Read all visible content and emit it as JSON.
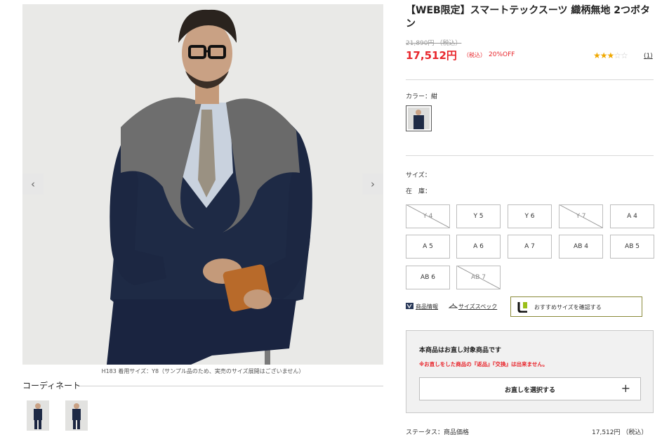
{
  "gallery": {
    "prev_label": "‹",
    "next_label": "›",
    "caption": "H183 着用サイズ：Y8（サンプル品のため、実売のサイズ展開はございません）",
    "coordinate_title": "コーディネート"
  },
  "product": {
    "title": "【WEB限定】スマートテックスーツ 織柄無地 2つボタン",
    "original_price": "21,890円 （税込）",
    "price": "17,512円",
    "price_tax": "（税込）",
    "discount": "20%OFF",
    "rating": {
      "value": 3,
      "max": 5,
      "filled": "★★★",
      "empty": "☆☆"
    },
    "review_count": "(1)"
  },
  "color": {
    "label": "カラー：",
    "value": "紺"
  },
  "size": {
    "label": "サイズ：",
    "stock_label": "在　庫：",
    "options": [
      {
        "label": "Y 4",
        "soldout": true
      },
      {
        "label": "Y 5",
        "soldout": false
      },
      {
        "label": "Y 6",
        "soldout": false
      },
      {
        "label": "Y 7",
        "soldout": true
      },
      {
        "label": "A 4",
        "soldout": false
      },
      {
        "label": "A 5",
        "soldout": false
      },
      {
        "label": "A 6",
        "soldout": false
      },
      {
        "label": "A 7",
        "soldout": false
      },
      {
        "label": "AB 4",
        "soldout": false
      },
      {
        "label": "AB 5",
        "soldout": false
      },
      {
        "label": "AB 6",
        "soldout": false
      },
      {
        "label": "AB 7",
        "soldout": true
      }
    ]
  },
  "links": {
    "product_info": "商品情報",
    "size_spec": "サイズスペック",
    "recommend": "おすすめサイズを確認する"
  },
  "alteration": {
    "title": "本商品はお直し対象商品です",
    "warning": "※お直しをした商品の『返品』『交換』は出来ません。",
    "button_label": "お直しを選択する",
    "button_icon": "+"
  },
  "status": {
    "label": "ステータス：商品価格",
    "value": "17,512円 （税込）"
  },
  "colors": {
    "accent_red": "#e8262c",
    "star": "#f0a800",
    "navy_suit": "#1e2a45"
  }
}
